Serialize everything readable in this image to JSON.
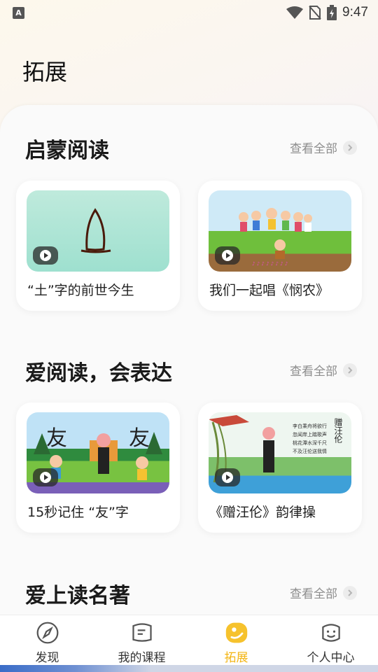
{
  "status_bar": {
    "time": "9:47",
    "app_indicator": "A"
  },
  "page": {
    "title": "拓展"
  },
  "sections": [
    {
      "title": "启蒙阅读",
      "view_all": "查看全部",
      "cards": [
        {
          "title": "“土”字的前世今生",
          "thumb_color": "#a6e3d2"
        },
        {
          "title": "我们一起唱《悯农》",
          "thumb_color": "#c9e6f4"
        }
      ]
    },
    {
      "title": "爱阅读，会表达",
      "view_all": "查看全部",
      "cards": [
        {
          "title": "15秒记住 “友”字",
          "thumb_color": "#b9ddf2",
          "overlay_text": [
            "友",
            "友"
          ]
        },
        {
          "title": "《赠汪伦》韵律操",
          "thumb_color": "#e8f2ef",
          "overlay_text": [
            "赠汪伦"
          ]
        }
      ]
    },
    {
      "title": "爱上读名著",
      "view_all": "查看全部"
    }
  ],
  "tab_bar": {
    "tabs": [
      {
        "label": "发现",
        "icon": "compass-icon",
        "active": false
      },
      {
        "label": "我的课程",
        "icon": "course-book-icon",
        "active": false
      },
      {
        "label": "拓展",
        "icon": "expand-icon",
        "active": true
      },
      {
        "label": "个人中心",
        "icon": "smiley-icon",
        "active": false
      }
    ]
  },
  "colors": {
    "accent": "#f3b514",
    "muted": "#8d8d8d"
  }
}
